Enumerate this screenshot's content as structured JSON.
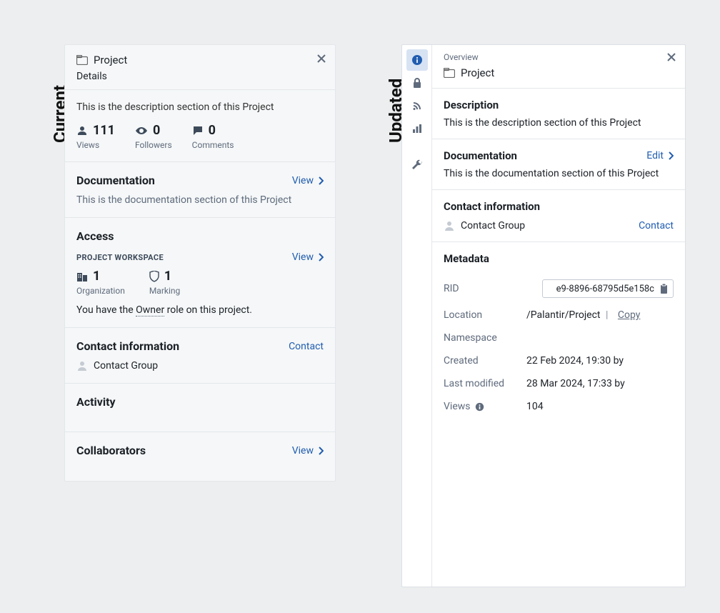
{
  "labels": {
    "current": "Current",
    "updated": "Updated"
  },
  "icons": {
    "folder": "folder-icon",
    "close": "close-icon",
    "person": "person-icon",
    "eye": "eye-icon",
    "comment": "comment-icon",
    "chevron": "chevron-right-icon",
    "org": "organization-icon",
    "shield": "shield-icon",
    "avatar": "avatar-icon",
    "info": "info-icon",
    "lock": "lock-icon",
    "rss": "feed-icon",
    "chart": "chart-icon",
    "wrench": "wrench-icon",
    "clipboard": "clipboard-icon"
  },
  "current": {
    "title": "Project",
    "subtitle": "Details",
    "description": "This is the description section of this Project",
    "stats": {
      "views": {
        "count": "111",
        "label": "Views"
      },
      "followers": {
        "count": "0",
        "label": "Followers"
      },
      "comments": {
        "count": "0",
        "label": "Comments"
      }
    },
    "documentation": {
      "title": "Documentation",
      "action": "View",
      "text": "This is the documentation section of this Project"
    },
    "access": {
      "title": "Access",
      "workspace_label": "PROJECT WORKSPACE",
      "action": "View",
      "org": {
        "count": "1",
        "label": "Organization"
      },
      "marking": {
        "count": "1",
        "label": "Marking"
      },
      "role_sentence_pre": "You have the ",
      "role_word": "Owner",
      "role_sentence_post": " role on this project."
    },
    "contact": {
      "title": "Contact information",
      "action": "Contact",
      "group": "Contact Group"
    },
    "activity": {
      "title": "Activity"
    },
    "collaborators": {
      "title": "Collaborators",
      "action": "View"
    }
  },
  "updated": {
    "overview_label": "Overview",
    "title": "Project",
    "description": {
      "title": "Description",
      "text": "This is the description section of this Project"
    },
    "documentation": {
      "title": "Documentation",
      "action": "Edit",
      "text": "This is the documentation section of this Project"
    },
    "contact": {
      "title": "Contact information",
      "group": "Contact Group",
      "action": "Contact"
    },
    "metadata": {
      "title": "Metadata",
      "rid_label": "RID",
      "rid_value": "e9-8896-68795d5e158c",
      "location_label": "Location",
      "location_value": "/Palantir/Project",
      "copy_label": "Copy",
      "namespace_label": "Namespace",
      "created_label": "Created",
      "created_value": "22 Feb 2024, 19:30 by",
      "modified_label": "Last modified",
      "modified_value": "28 Mar 2024, 17:33 by",
      "views_label": "Views",
      "views_value": "104"
    }
  }
}
